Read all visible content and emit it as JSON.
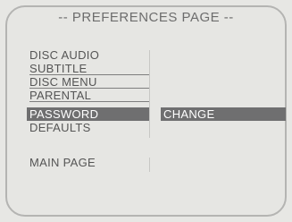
{
  "screen": {
    "title": "-- PREFERENCES PAGE --"
  },
  "menu": {
    "items": [
      {
        "label": "DISC AUDIO"
      },
      {
        "label": "SUBTITLE"
      },
      {
        "label": "DISC MENU"
      },
      {
        "label": "PARENTAL"
      },
      {
        "label": "PASSWORD"
      },
      {
        "label": "DEFAULTS"
      }
    ],
    "selected": "PASSWORD",
    "main_page_label": "MAIN PAGE"
  },
  "submenu": {
    "options": [
      {
        "label": "CHANGE"
      }
    ],
    "selected": "CHANGE"
  },
  "colors": {
    "background": "#e7e7e4",
    "highlight": "#6f6f70",
    "text": "#555555",
    "title_text": "#6d6d6d"
  }
}
